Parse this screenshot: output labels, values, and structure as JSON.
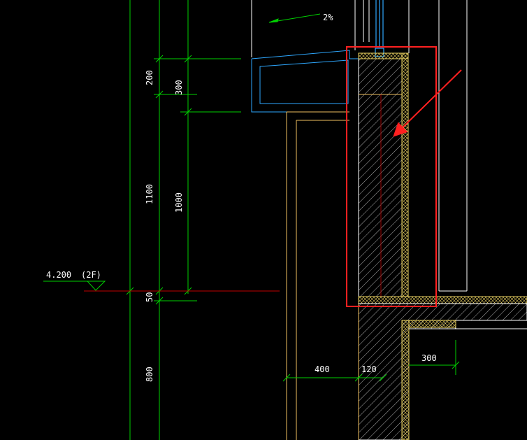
{
  "drawing": {
    "background_color": "#000000",
    "colors": {
      "dimension_line": "#00d000",
      "cad_lines_white": "#ffffff",
      "wall_outline": "#f0c060",
      "parapet_cyan": "#2ea8ff",
      "insulation_yellow": "#e8d060",
      "floor_line": "#c00000",
      "highlight_box": "#ff2020",
      "annotation_arrow": "#ff2020"
    },
    "slope_label": "2%",
    "level_label": "4.200",
    "floor_label": "(2F)",
    "dimensions_outer": [
      "200",
      "1100",
      "50",
      "800"
    ],
    "dimensions_inner": [
      "300",
      "1000"
    ],
    "dimensions_horizontal": [
      "400",
      "120",
      "300"
    ]
  }
}
